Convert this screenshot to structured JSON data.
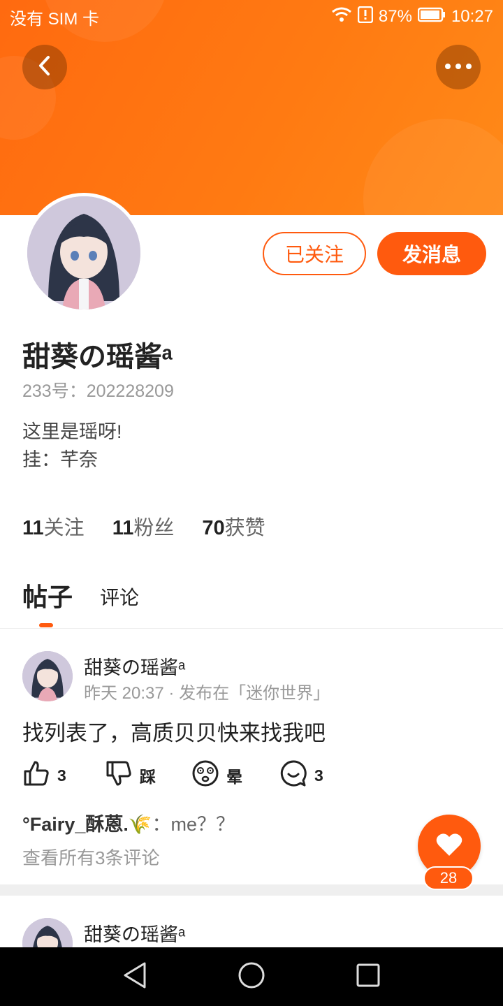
{
  "status_bar": {
    "carrier": "没有 SIM 卡",
    "battery": "87%",
    "time": "10:27"
  },
  "profile": {
    "name": "甜葵の瑶酱ᵃ",
    "id_text": "233号：202228209",
    "bio_lines": [
      "这里是瑶呀!",
      "挂：芊奈"
    ],
    "followed_label": "已关注",
    "message_label": "发消息"
  },
  "stats": [
    {
      "num": "11",
      "label": "关注"
    },
    {
      "num": "11",
      "label": "粉丝"
    },
    {
      "num": "70",
      "label": "获赞"
    }
  ],
  "tabs": [
    {
      "label": "帖子"
    },
    {
      "label": "评论"
    }
  ],
  "posts": [
    {
      "author": "甜葵の瑶酱ᵃ",
      "time": "昨天 20:37",
      "published_in": "发布在「迷你世界」",
      "text": "找列表了，高质贝贝快来找我吧",
      "actions": {
        "like": "3",
        "dislike": "踩",
        "dizzy": "晕",
        "comment": "3"
      },
      "top_comment": {
        "author": "°Fairy_酥蒽.🌾",
        "sep": "：",
        "text": "me？？"
      },
      "view_all": "查看所有3条评论"
    },
    {
      "author": "甜葵の瑶酱ᵃ"
    }
  ],
  "fab": {
    "count": "28"
  },
  "colors": {
    "accent": "#ff5a0e",
    "header": "#ff7412"
  },
  "icons": [
    "back-icon",
    "more-icon",
    "wifi-icon",
    "alert-icon",
    "battery-icon",
    "thumb-up-icon",
    "thumb-down-icon",
    "dizzy-icon",
    "comment-icon",
    "heart-icon",
    "nav-back-icon",
    "nav-home-icon",
    "nav-recents-icon"
  ]
}
